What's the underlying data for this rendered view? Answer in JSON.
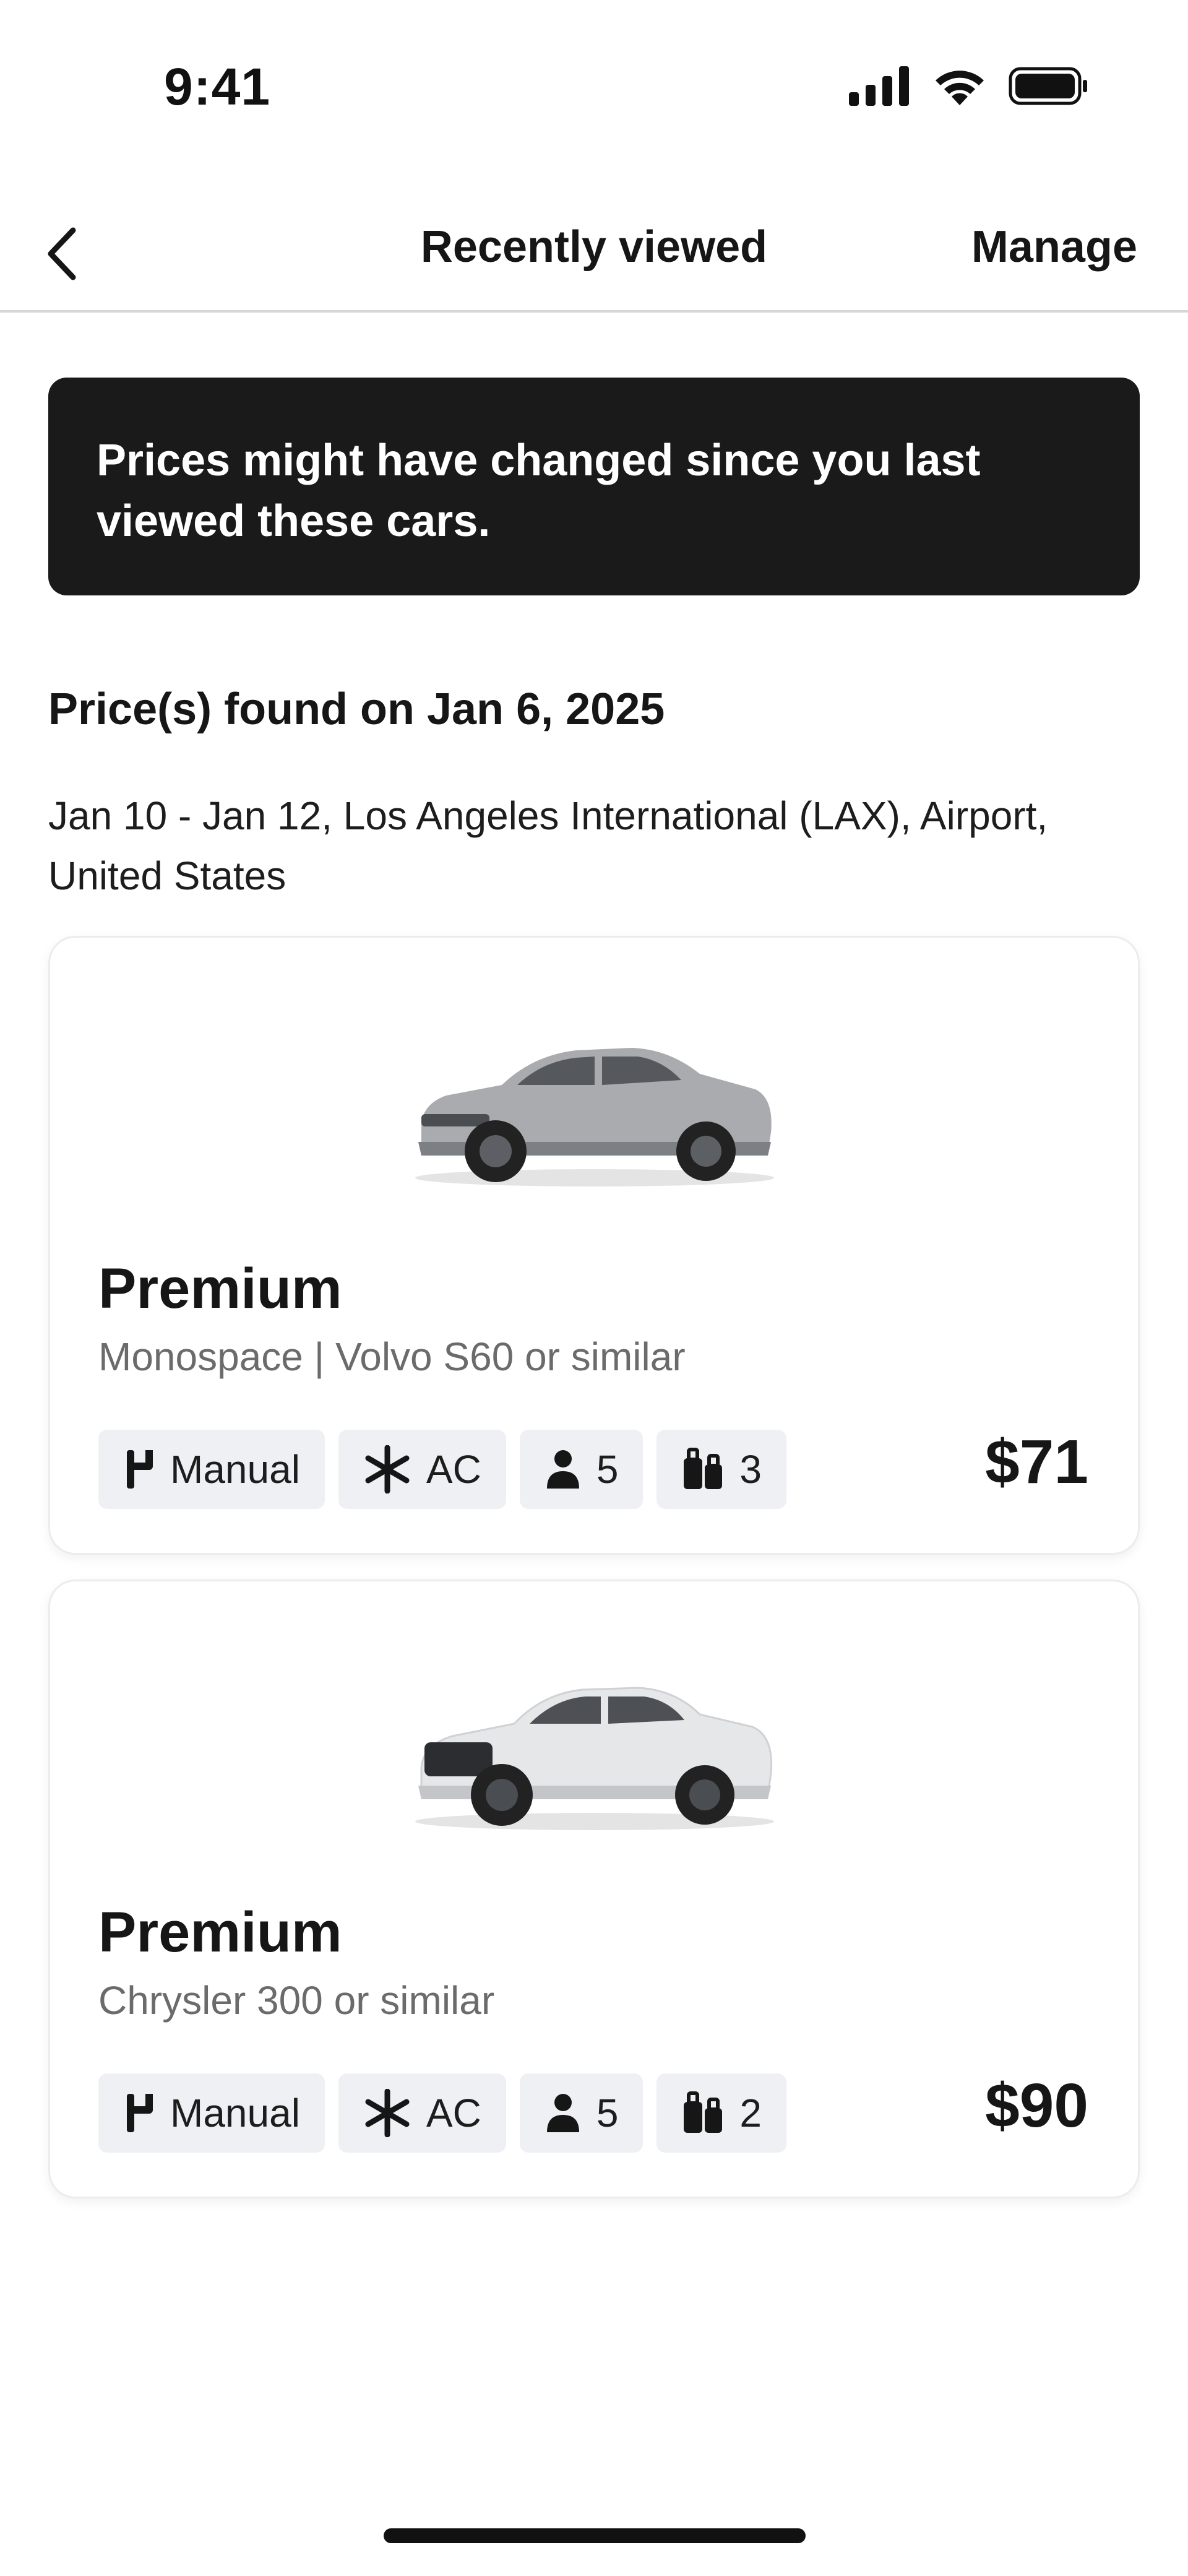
{
  "status_bar": {
    "time": "9:41"
  },
  "nav": {
    "title": "Recently viewed",
    "manage_label": "Manage"
  },
  "banner": {
    "text": "Prices might have changed since you last viewed these cars."
  },
  "summary": {
    "found_title": "Price(s) found on Jan 6, 2025",
    "trip_details": "Jan 10 - Jan 12, Los Angeles International (LAX), Airport, United States"
  },
  "cars": [
    {
      "title": "Premium",
      "subtitle": "Monospace | Volvo S60 or similar",
      "transmission": "Manual",
      "ac": "AC",
      "seats": "5",
      "bags": "3",
      "price": "$71",
      "body_color": "#a9abae"
    },
    {
      "title": "Premium",
      "subtitle": "Chrysler 300 or similar",
      "transmission": "Manual",
      "ac": "AC",
      "seats": "5",
      "bags": "2",
      "price": "$90",
      "body_color": "#e6e7e9"
    }
  ],
  "icons": {
    "back": "chevron-left-icon",
    "transmission": "gear-shift-icon",
    "ac": "snowflake-icon",
    "seats": "person-icon",
    "bags": "luggage-icon"
  }
}
